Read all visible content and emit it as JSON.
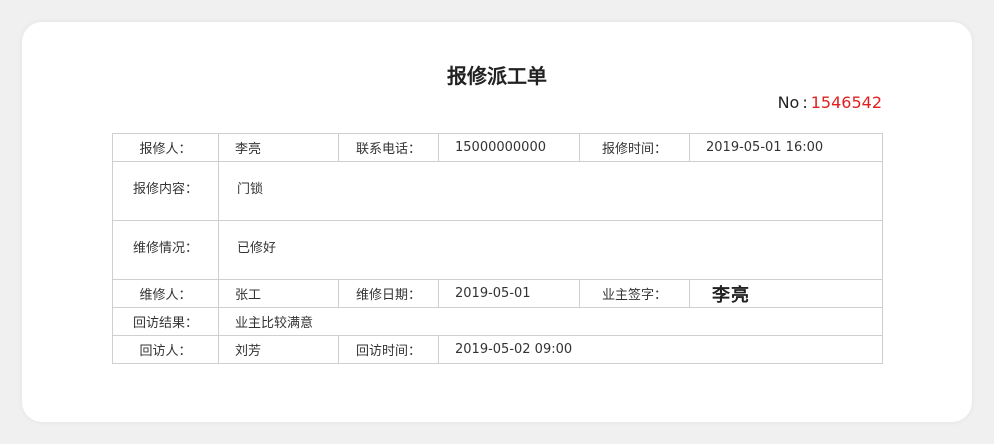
{
  "title": "报修派工单",
  "order": {
    "label": "No",
    "separator": ":",
    "number": "1546542",
    "number_color": "#e02020"
  },
  "fields": {
    "reporter_label": "报修人：",
    "reporter": "李亮",
    "phone_label": "联系电话：",
    "phone": "15000000000",
    "report_time_label": "报修时间：",
    "report_time": "2019-05-01 16:00",
    "content_label": "报修内容：",
    "content": "门锁",
    "status_label": "维修情况：",
    "status": "已修好",
    "repairer_label": "维修人：",
    "repairer": "张工",
    "repair_date_label": "维修日期：",
    "repair_date": "2019-05-01",
    "owner_sign_label": "业主签字：",
    "owner_sign": "李亮",
    "followup_result_label": "回访结果：",
    "followup_result": "业主比较满意",
    "followup_person_label": "回访人：",
    "followup_person": "刘芳",
    "followup_time_label": "回访时间：",
    "followup_time": "2019-05-02  09:00"
  }
}
